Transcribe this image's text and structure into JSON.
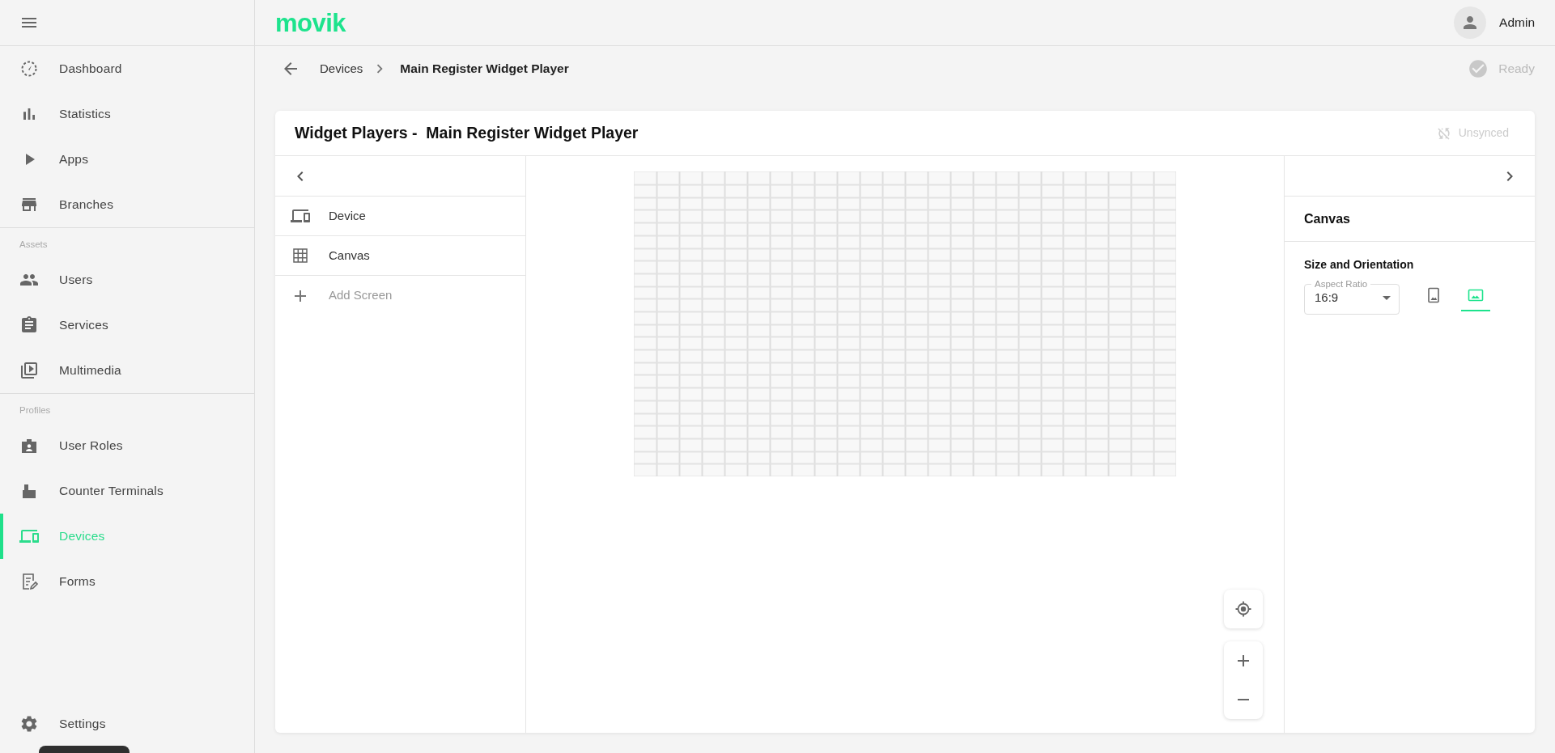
{
  "header": {
    "logo": "movik",
    "user": "Admin"
  },
  "sidebar": {
    "groups": [
      {
        "items": [
          {
            "label": "Dashboard",
            "selected": false
          },
          {
            "label": "Statistics",
            "selected": false
          },
          {
            "label": "Apps",
            "selected": false
          },
          {
            "label": "Branches",
            "selected": false
          }
        ]
      },
      {
        "heading": "Assets",
        "items": [
          {
            "label": "Users",
            "selected": false
          },
          {
            "label": "Services",
            "selected": false
          },
          {
            "label": "Multimedia",
            "selected": false
          }
        ]
      },
      {
        "heading": "Profiles",
        "items": [
          {
            "label": "User Roles",
            "selected": false
          },
          {
            "label": "Counter Terminals",
            "selected": false
          },
          {
            "label": "Devices",
            "selected": true
          },
          {
            "label": "Forms",
            "selected": false
          }
        ]
      }
    ],
    "footer_items": [
      {
        "label": "Settings",
        "selected": false
      }
    ]
  },
  "breadcrumb": {
    "items": [
      "Devices",
      "Main Register Widget Player"
    ],
    "status": "Ready"
  },
  "editor": {
    "title": "Widget Players -  Main Register Widget Player",
    "sync_status": "Unsynced",
    "screens": [
      {
        "kind": "item",
        "label": "Device"
      },
      {
        "kind": "item",
        "label": "Canvas"
      },
      {
        "kind": "add",
        "label": "Add Screen"
      }
    ],
    "properties": {
      "heading": "Canvas",
      "section": "Size and Orientation",
      "aspect_ratio": {
        "label": "Aspect Ratio",
        "value": "16:9"
      },
      "orientations": [
        {
          "selected": false
        },
        {
          "selected": true
        }
      ]
    }
  }
}
